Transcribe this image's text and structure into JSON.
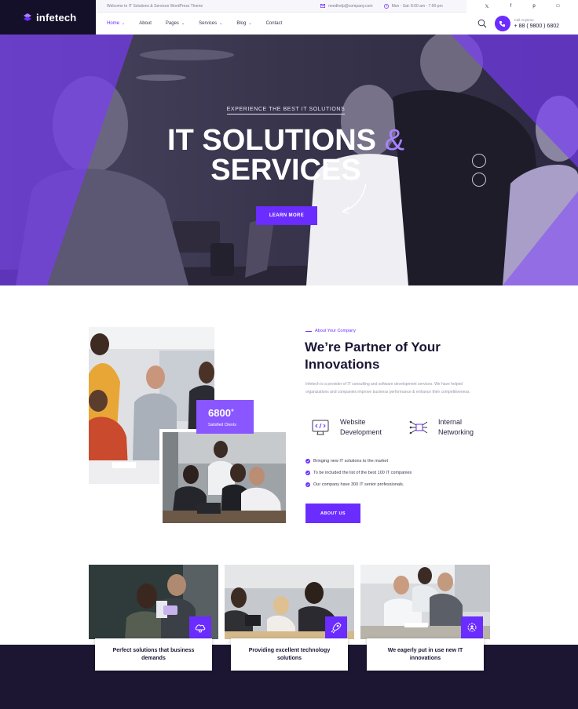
{
  "colors": {
    "accent": "#6b2cff",
    "accent_light": "#8a56ff",
    "dark": "#15102a",
    "text": "#1c1533"
  },
  "logo": {
    "text": "infetech",
    "icon": "logo-mark-icon"
  },
  "topbar": {
    "welcome": "Welcome to IT Solutions & Services WordPress Theme",
    "email": "needhelp@company.com",
    "hours": "Mon - Sat: 8:00 am - 7:00 pm"
  },
  "social": [
    "twitter-icon",
    "facebook-icon",
    "pinterest-icon",
    "instagram-icon"
  ],
  "nav": {
    "items": [
      {
        "label": "Home",
        "dropdown": true,
        "active": true
      },
      {
        "label": "About",
        "dropdown": false
      },
      {
        "label": "Pages",
        "dropdown": true
      },
      {
        "label": "Services",
        "dropdown": true
      },
      {
        "label": "Blog",
        "dropdown": true
      },
      {
        "label": "Contact",
        "dropdown": false
      }
    ],
    "call_label": "Call Anytime",
    "call_number": "+ 88 ( 9800 ) 6802"
  },
  "hero": {
    "eyebrow": "EXPERIENCE THE BEST IT SOLUTIONS",
    "title_line1": "IT SOLUTIONS",
    "title_amp": "&",
    "title_line2": "SERVICES",
    "button": "LEARN MORE"
  },
  "about": {
    "eyebrow": "About Your Company",
    "title": "We’re Partner of Your Innovations",
    "description": "Infetech is a provider of IT consulting and software development services. We have helped organizations and companies improve business performance & enhance their competitiveness.",
    "stat_value": "6800",
    "stat_suffix": "+",
    "stat_label": "Satisfied Clients",
    "features": [
      {
        "label": "Website Development",
        "icon": "website-development-icon"
      },
      {
        "label": "Internal Networking",
        "icon": "internal-networking-icon"
      }
    ],
    "checklist": [
      "Bringing new IT solutions to the market",
      "To be included the list of the best 100 IT companies",
      "Our company have 300 IT senior professionals."
    ],
    "button": "ABOUT US"
  },
  "cards": [
    {
      "caption": "Perfect solutions that business demands",
      "icon": "cloud-settings-icon"
    },
    {
      "caption": "Providing excellent technology solutions",
      "icon": "rocket-icon"
    },
    {
      "caption": "We eagerly put in use new IT innovations",
      "icon": "gear-user-icon"
    }
  ]
}
